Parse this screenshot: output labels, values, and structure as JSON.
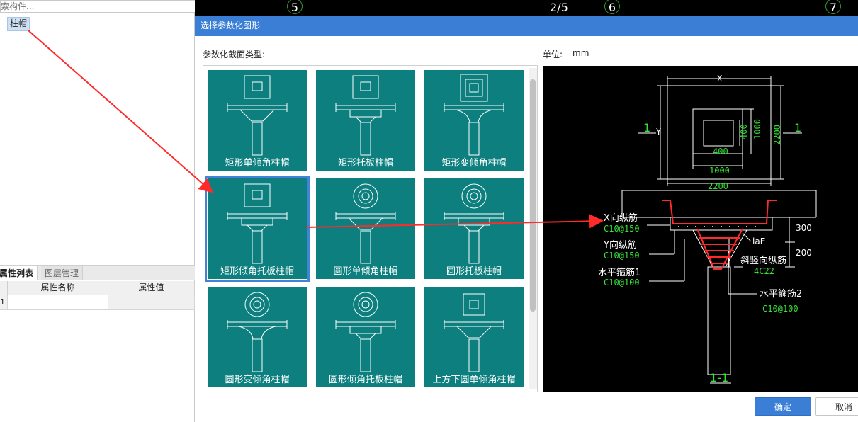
{
  "search": {
    "placeholder": "搜索构件..."
  },
  "tree": {
    "item": "柱帽"
  },
  "panel_tabs": {
    "props": "属性列表",
    "layers": "图层管理"
  },
  "prop_grid": {
    "col_name": "属性名称",
    "col_value": "属性值",
    "row_num": "1"
  },
  "cad_axis": [
    "5",
    "2/5",
    "6",
    "7"
  ],
  "dialog": {
    "title": "选择参数化图形",
    "section_label": "参数化截面类型:",
    "unit_label": "单位:",
    "unit_value": "mm",
    "ok": "确定",
    "cancel": "取消"
  },
  "tiles": [
    {
      "label": "矩形单倾角柱帽",
      "kind": "rect-single"
    },
    {
      "label": "矩形托板柱帽",
      "kind": "rect-plate"
    },
    {
      "label": "矩形变倾角柱帽",
      "kind": "rect-var"
    },
    {
      "label": "矩形倾角托板柱帽",
      "kind": "rect-slope-plate"
    },
    {
      "label": "圆形单倾角柱帽",
      "kind": "round-single"
    },
    {
      "label": "圆形托板柱帽",
      "kind": "round-plate"
    },
    {
      "label": "圆形变倾角柱帽",
      "kind": "round-var"
    },
    {
      "label": "圆形倾角托板柱帽",
      "kind": "round-slope-plate"
    },
    {
      "label": "上方下圆单倾角柱帽",
      "kind": "square-round"
    }
  ],
  "selected_tile": 3,
  "colors": {
    "tile_bg": "#0d7f7f",
    "title_bar": "#3b7ed6",
    "cad_green": "#35e035",
    "cad_red": "#ff2a2a"
  },
  "preview": {
    "dim_x": "X",
    "dim_y": "Y",
    "dim_400a": "400",
    "dim_400b": "400",
    "dim_1000a": "1000",
    "dim_1000b": "1000",
    "dim_2200a": "2200",
    "dim_2200b": "2200",
    "section_mark_left": "1",
    "section_mark_right": "1",
    "x_bar": "X向纵筋",
    "x_bar_spec": "C10@150",
    "y_bar": "Y向纵筋",
    "y_bar_spec": "C10@150",
    "h_stirrup1": "水平箍筋1",
    "h_stirrup1_spec": "C10@100",
    "slope_bar": "斜竖向纵筋",
    "slope_bar_spec": "4C22",
    "h_stirrup2": "水平箍筋2",
    "h_stirrup2_spec": "C10@100",
    "lae": "laE",
    "dim_300": "300",
    "dim_200": "200",
    "section_title": "1-1"
  }
}
